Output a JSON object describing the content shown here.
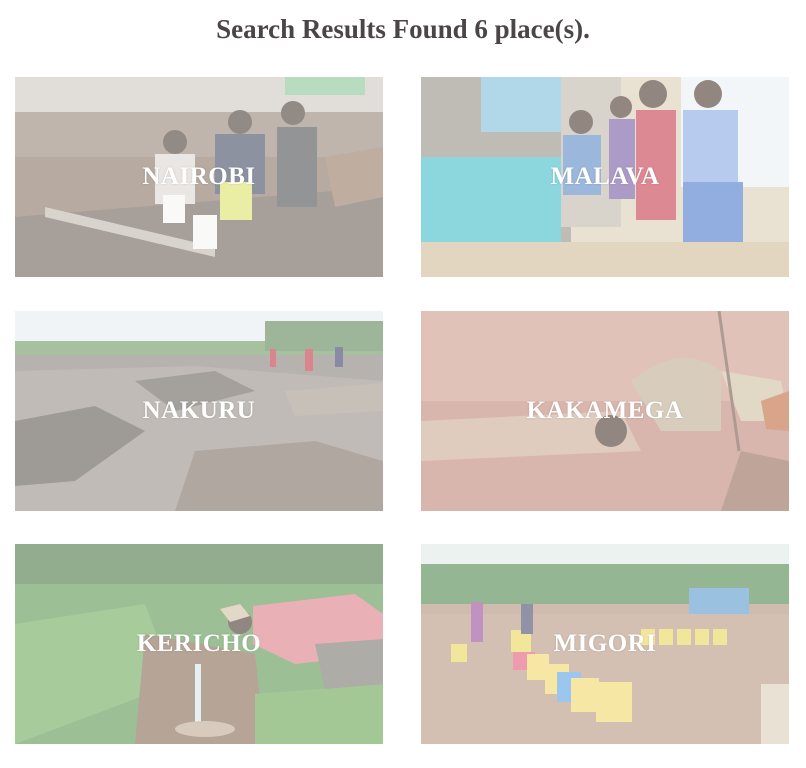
{
  "results": {
    "title": "Search Results Found 6 place(s).",
    "places": [
      {
        "name": "NAIROBI",
        "photo": "children-filling-jerrycans-at-pipe"
      },
      {
        "name": "MALAVA",
        "photo": "children-at-school-water-tap"
      },
      {
        "name": "NAKURU",
        "photo": "eroded-flooded-ground"
      },
      {
        "name": "KAKAMEGA",
        "photo": "child-drinking-from-puddle"
      },
      {
        "name": "KERICHO",
        "photo": "man-collecting-spring-water"
      },
      {
        "name": "MIGORI",
        "photo": "queue-of-yellow-jerrycans"
      }
    ]
  }
}
